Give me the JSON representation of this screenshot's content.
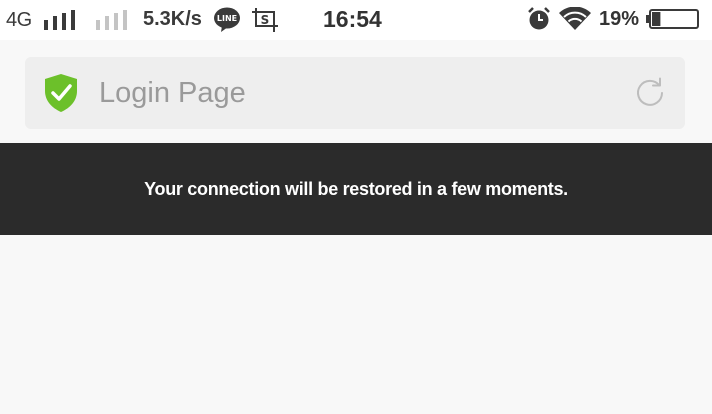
{
  "status_bar": {
    "network_type": "4G",
    "speed": "5.3K/s",
    "time": "16:54",
    "battery": "19%",
    "line_badge": "LINE",
    "screenshot_badge": "S",
    "icons": [
      "signal-bars-icon",
      "signal-bars-weak-icon",
      "line-app-icon",
      "screenshot-icon",
      "alarm-icon",
      "wifi-icon",
      "battery-icon"
    ],
    "battery_level": 0.19
  },
  "address_bar": {
    "title": "Login Page",
    "secure_icon": "shield-check-icon",
    "reload_icon": "reload-icon",
    "accent_color": "#6cc02a"
  },
  "banner": {
    "message": "Your connection will be restored in a few moments.",
    "background": "#2b2b2b"
  }
}
